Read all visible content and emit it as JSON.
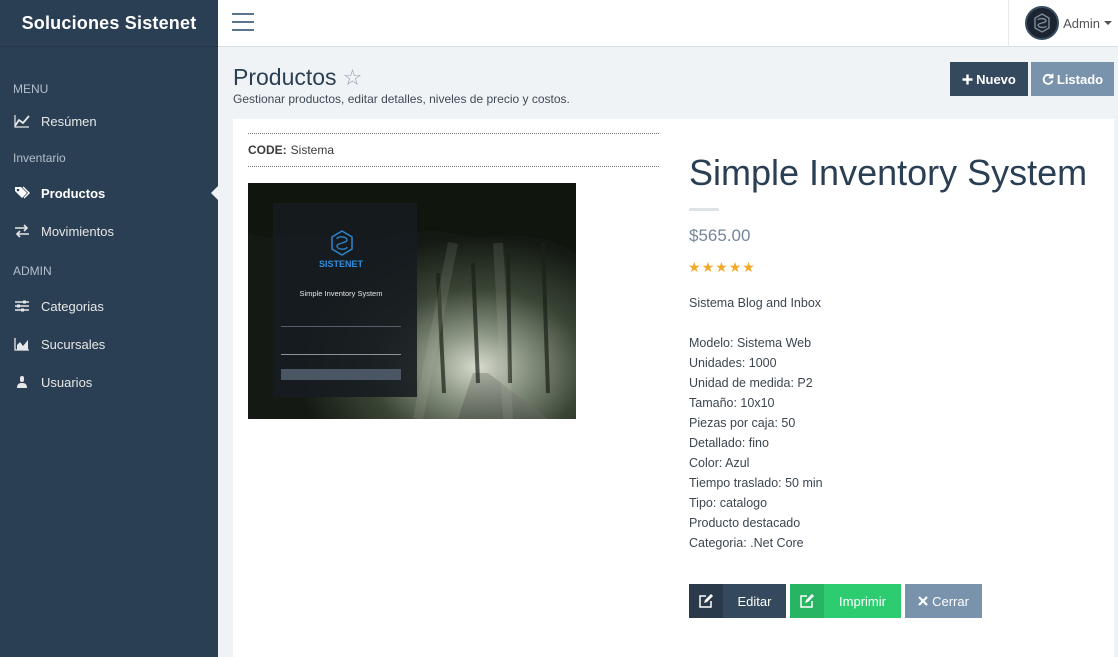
{
  "app": {
    "brand": "Soluciones Sistenet"
  },
  "sidebar": {
    "sections": [
      {
        "title": "MENU",
        "items": [
          {
            "label": "Resúmen",
            "icon": "line-chart-icon"
          }
        ]
      },
      {
        "title": "Inventario",
        "items": [
          {
            "label": "Productos",
            "icon": "tags-icon",
            "active": true
          },
          {
            "label": "Movimientos",
            "icon": "exchange-icon"
          }
        ]
      },
      {
        "title": "ADMIN",
        "items": [
          {
            "label": "Categorias",
            "icon": "sliders-icon"
          },
          {
            "label": "Sucursales",
            "icon": "bar-chart-icon"
          },
          {
            "label": "Usuarios",
            "icon": "user-icon"
          }
        ]
      }
    ]
  },
  "topbar": {
    "user": "Admin"
  },
  "page": {
    "title": "Productos",
    "subtitle": "Gestionar productos, editar detalles, niveles de precio y costos.",
    "btn_new": "Nuevo",
    "btn_list": "Listado"
  },
  "product": {
    "code_label": "CODE:",
    "code_value": "Sistema",
    "image_brand": "SISTENET",
    "image_title": "Simple Inventory System",
    "name": "Simple Inventory System",
    "price": "$565.00",
    "rating": 5,
    "description": "Sistema Blog and Inbox",
    "details": [
      "Modelo: Sistema Web",
      "Unidades: 1000",
      "Unidad de medida: P2",
      "Tamaño: 10x10",
      "Piezas por caja: 50",
      "Detallado: fino",
      "Color: Azul",
      "Tiempo traslado: 50 min",
      "Tipo: catalogo",
      "Producto destacado",
      "Categoria: .Net Core"
    ]
  },
  "actions": {
    "edit": "Editar",
    "print": "Imprimir",
    "close": "Cerrar"
  },
  "colors": {
    "sidebar": "#2a3f54",
    "dark_button": "#34495e",
    "muted_button": "#7a93ad",
    "success": "#2ecc71",
    "star": "#f2a929"
  }
}
